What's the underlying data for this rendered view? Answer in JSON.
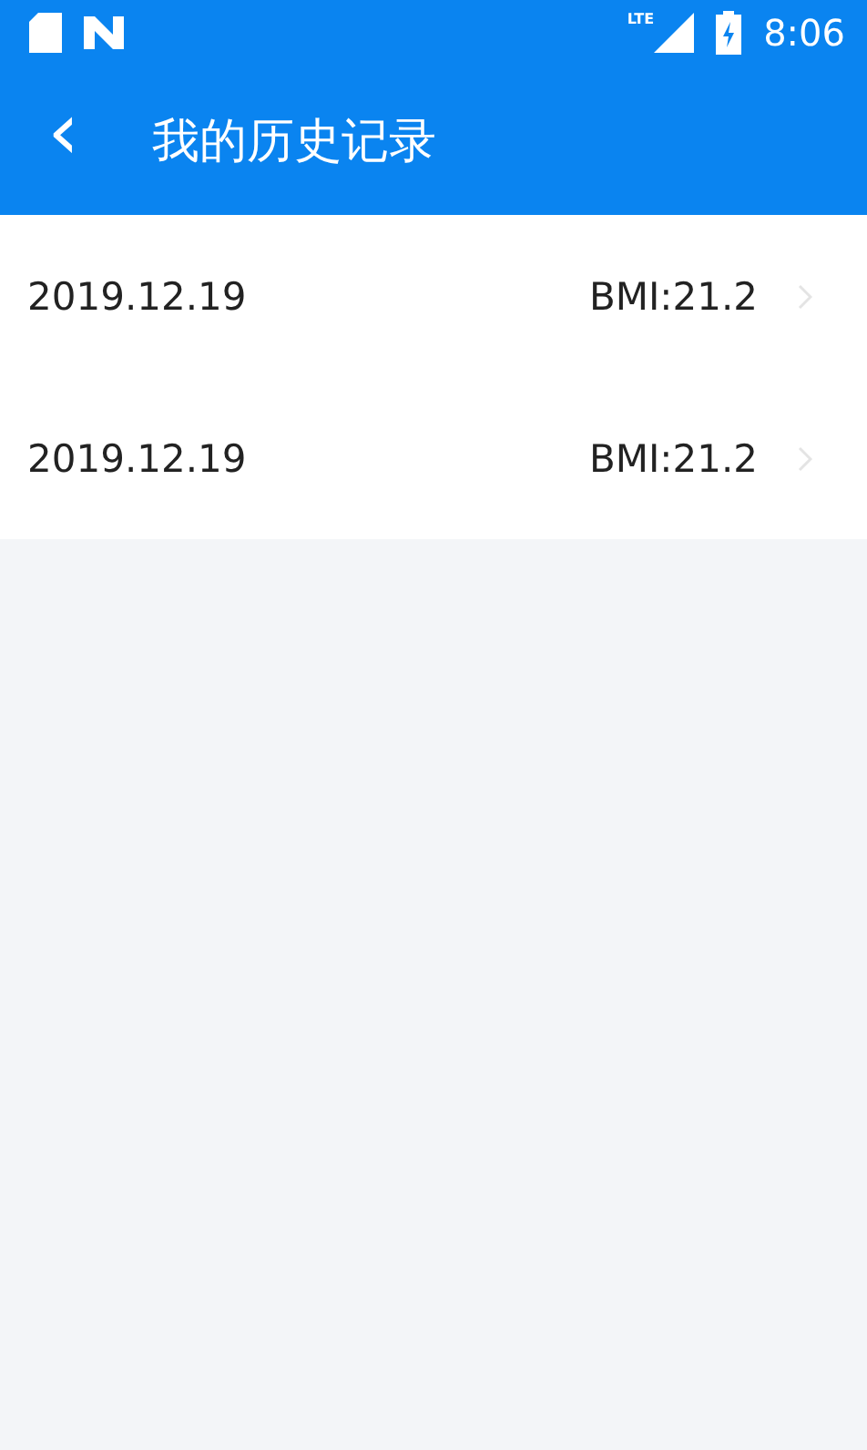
{
  "status_bar": {
    "network": "LTE",
    "time": "8:06"
  },
  "toolbar": {
    "back": "‹",
    "title": "我的历史记录"
  },
  "records": [
    {
      "date": "2019.12.19",
      "bmi": "BMI:21.2"
    },
    {
      "date": "2019.12.19",
      "bmi": "BMI:21.2"
    }
  ]
}
